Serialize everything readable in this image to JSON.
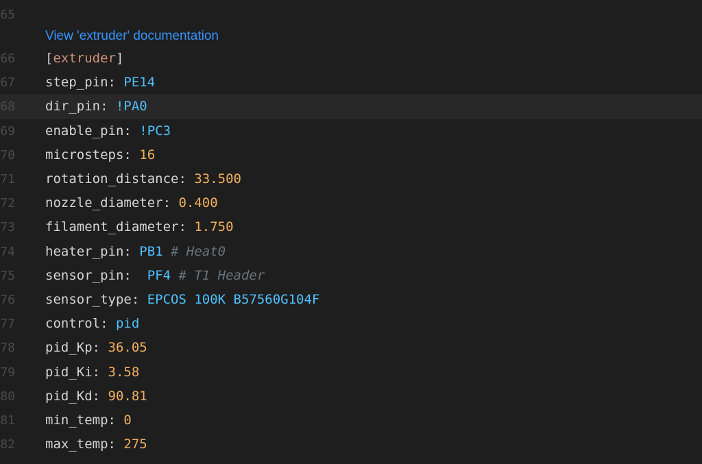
{
  "editor": {
    "codelens": "View 'extruder' documentation",
    "lines": [
      {
        "no": "65",
        "segments": []
      },
      {
        "no": "66",
        "segments": [
          {
            "t": "[",
            "c": "bracket"
          },
          {
            "t": "extruder",
            "c": "section"
          },
          {
            "t": "]",
            "c": "bracket"
          }
        ]
      },
      {
        "no": "67",
        "segments": [
          {
            "t": "step_pin: ",
            "c": "key"
          },
          {
            "t": "PE14",
            "c": "str"
          }
        ]
      },
      {
        "no": "68",
        "active": true,
        "segments": [
          {
            "t": "dir_pin: ",
            "c": "key"
          },
          {
            "t": "!PA0",
            "c": "str"
          }
        ]
      },
      {
        "no": "69",
        "segments": [
          {
            "t": "enable_pin: ",
            "c": "key"
          },
          {
            "t": "!PC3",
            "c": "str"
          }
        ]
      },
      {
        "no": "70",
        "segments": [
          {
            "t": "microsteps: ",
            "c": "key"
          },
          {
            "t": "16",
            "c": "num"
          }
        ]
      },
      {
        "no": "71",
        "segments": [
          {
            "t": "rotation_distance: ",
            "c": "key"
          },
          {
            "t": "33.500",
            "c": "num"
          }
        ]
      },
      {
        "no": "72",
        "segments": [
          {
            "t": "nozzle_diameter: ",
            "c": "key"
          },
          {
            "t": "0.400",
            "c": "num"
          }
        ]
      },
      {
        "no": "73",
        "segments": [
          {
            "t": "filament_diameter: ",
            "c": "key"
          },
          {
            "t": "1.750",
            "c": "num"
          }
        ]
      },
      {
        "no": "74",
        "segments": [
          {
            "t": "heater_pin: ",
            "c": "key"
          },
          {
            "t": "PB1",
            "c": "str"
          },
          {
            "t": " # Heat0",
            "c": "comment"
          }
        ]
      },
      {
        "no": "75",
        "segments": [
          {
            "t": "sensor_pin:  ",
            "c": "key"
          },
          {
            "t": "PF4",
            "c": "str"
          },
          {
            "t": " # T1 Header",
            "c": "comment"
          }
        ]
      },
      {
        "no": "76",
        "segments": [
          {
            "t": "sensor_type: ",
            "c": "key"
          },
          {
            "t": "EPCOS 100K B57560G104F",
            "c": "str"
          }
        ]
      },
      {
        "no": "77",
        "segments": [
          {
            "t": "control: ",
            "c": "key"
          },
          {
            "t": "pid",
            "c": "str"
          }
        ]
      },
      {
        "no": "78",
        "segments": [
          {
            "t": "pid_Kp: ",
            "c": "key"
          },
          {
            "t": "36.05",
            "c": "num"
          }
        ]
      },
      {
        "no": "79",
        "segments": [
          {
            "t": "pid_Ki: ",
            "c": "key"
          },
          {
            "t": "3.58",
            "c": "num"
          }
        ]
      },
      {
        "no": "80",
        "segments": [
          {
            "t": "pid_Kd: ",
            "c": "key"
          },
          {
            "t": "90.81",
            "c": "num"
          }
        ]
      },
      {
        "no": "81",
        "segments": [
          {
            "t": "min_temp: ",
            "c": "key"
          },
          {
            "t": "0",
            "c": "num"
          }
        ]
      },
      {
        "no": "82",
        "segments": [
          {
            "t": "max_temp: ",
            "c": "key"
          },
          {
            "t": "275",
            "c": "num"
          }
        ]
      }
    ]
  },
  "colors": {
    "background": "#1e1e1e",
    "codelens": "#3794ff",
    "string_value": "#4fc1ff",
    "number_value": "#f2b05e",
    "section_name": "#ce9178",
    "comment": "#6a737d"
  }
}
